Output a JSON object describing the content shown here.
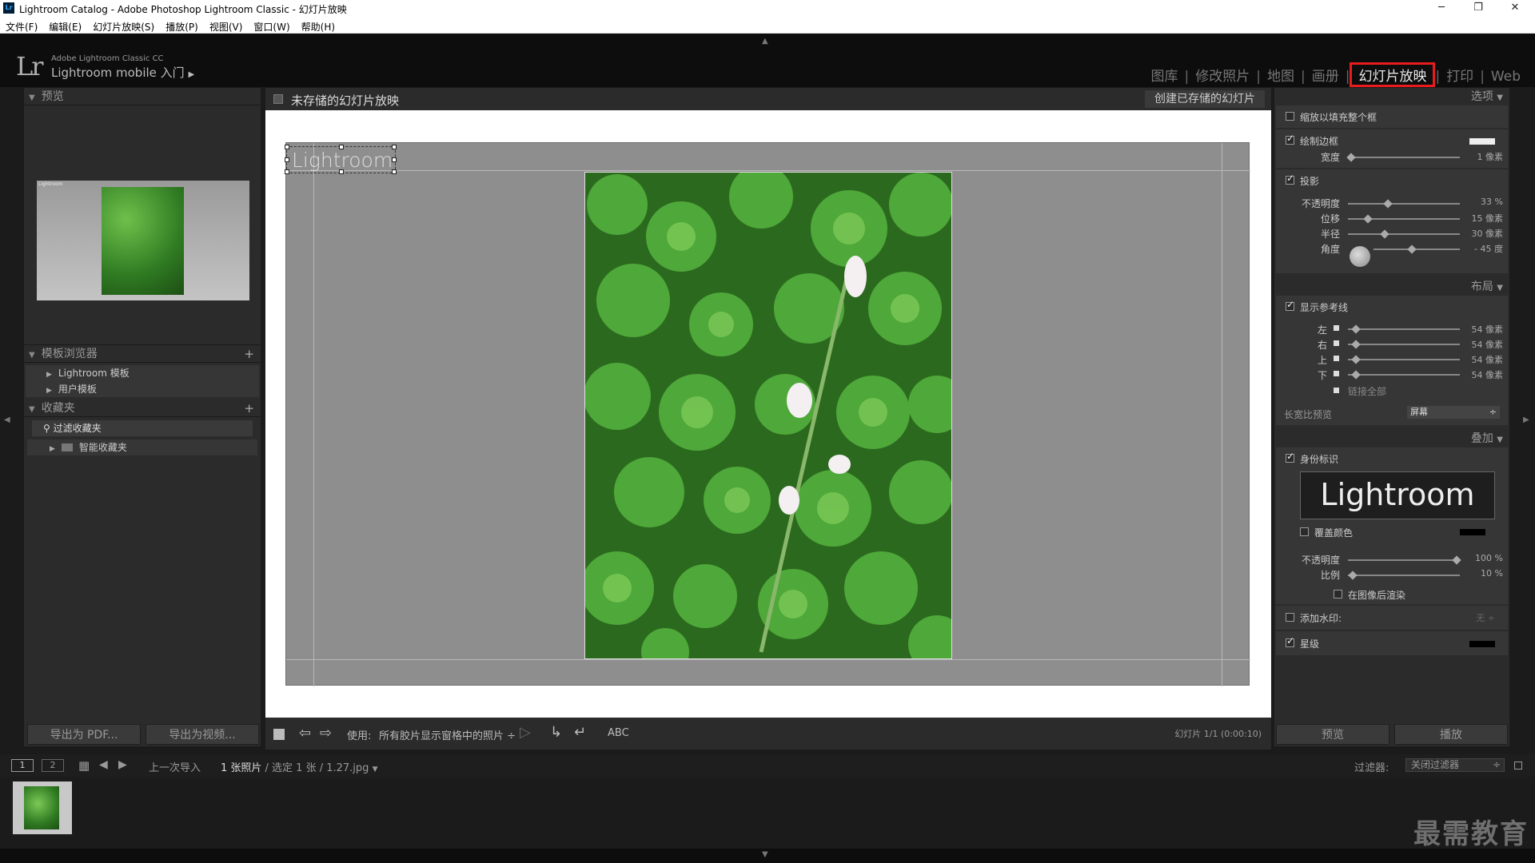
{
  "window": {
    "title": "Lightroom Catalog - Adobe Photoshop Lightroom Classic - 幻灯片放映",
    "icon": "Lr"
  },
  "menu": [
    "文件(F)",
    "编辑(E)",
    "幻灯片放映(S)",
    "播放(P)",
    "视图(V)",
    "窗口(W)",
    "帮助(H)"
  ],
  "brand": {
    "product": "Adobe Lightroom Classic CC",
    "mobile": "Lightroom mobile 入门",
    "logo": "Lr"
  },
  "modules": [
    "图库",
    "修改照片",
    "地图",
    "画册",
    "幻灯片放映",
    "打印",
    "Web"
  ],
  "active_module": "幻灯片放映",
  "left": {
    "preview_title": "预览",
    "template_browser": "模板浏览器",
    "templates": [
      "Lightroom 模板",
      "用户模板"
    ],
    "collections_title": "收藏夹",
    "filter_collections": "过滤收藏夹",
    "smart_collections": "智能收藏夹",
    "export_pdf": "导出为 PDF...",
    "export_video": "导出为视频...",
    "preview_label": "Lightroom"
  },
  "center": {
    "title": "未存储的幻灯片放映",
    "create_btn": "创建已存储的幻灯片",
    "identity_plate": "Lightroom",
    "use_label": "使用:",
    "use_value": "所有胶片显示窗格中的照片",
    "abc": "ABC",
    "slide_info": "幻灯片 1/1 (0:00:10)"
  },
  "right": {
    "options_title": "选项",
    "zoom_fill": "缩放以填充整个框",
    "stroke_border": "绘制边框",
    "width_label": "宽度",
    "width_val": "1 像素",
    "shadow": "投影",
    "opacity_label": "不透明度",
    "opacity_val": "33 %",
    "offset_label": "位移",
    "offset_val": "15 像素",
    "radius_label": "半径",
    "radius_val": "30 像素",
    "angle_label": "角度",
    "angle_val": "- 45 度",
    "layout_title": "布局",
    "show_guides": "显示参考线",
    "left_l": "左",
    "right_l": "右",
    "top_l": "上",
    "bottom_l": "下",
    "margin_val": "54 像素",
    "link_all": "链接全部",
    "aspect_label": "长宽比预览",
    "aspect_val": "屏幕",
    "overlay_title": "叠加",
    "identity": "身份标识",
    "identity_text": "Lightroom",
    "override_color": "覆盖颜色",
    "id_opacity_label": "不透明度",
    "id_opacity_val": "100 %",
    "scale_label": "比例",
    "scale_val": "10 %",
    "render_behind": "在图像后渲染",
    "watermark": "添加水印:",
    "watermark_val": "无 ÷",
    "rating": "星级",
    "preview_btn": "预览",
    "play_btn": "播放",
    "opacity_level": 0.33,
    "offset_level": 0.15,
    "radius_level": 0.3,
    "margin_level": 0.05,
    "id_opacity_level": 0.95,
    "scale_level": 0.03
  },
  "filmstrip": {
    "page1": "1",
    "page2": "2",
    "source": "上一次导入",
    "count": "1 张照片",
    "selection": " / 选定 1 张 / 1.27.jpg",
    "filter_label": "过滤器:",
    "filter_val": "关闭过滤器"
  },
  "watermark_text": "最需教育",
  "colors": {
    "active_border": "#e81c1c",
    "panel": "#2b2b2b",
    "stage": "#ffffff",
    "slide_bg": "#8e8e8e"
  }
}
